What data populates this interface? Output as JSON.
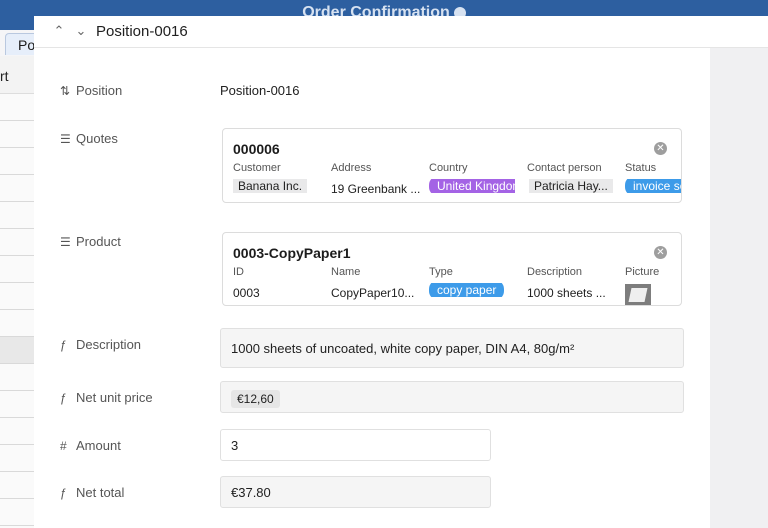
{
  "background": {
    "app_title": "Order Confirmation",
    "tab_label": "Po",
    "toolbar_text": "rt"
  },
  "modal": {
    "title": "Position-0016",
    "fields": {
      "position": {
        "label": "Position",
        "value": "Position-0016"
      },
      "quotes": {
        "label": "Quotes",
        "card": {
          "title": "000006",
          "columns": [
            "Customer",
            "Address",
            "Country",
            "Contact person",
            "Status"
          ],
          "values": [
            "Banana Inc.",
            "19 Greenbank ...",
            "United Kingdom",
            "Patricia Hay...",
            "invoice se"
          ]
        }
      },
      "product": {
        "label": "Product",
        "card": {
          "title": "0003-CopyPaper1",
          "columns": [
            "ID",
            "Name",
            "Type",
            "Description",
            "Picture"
          ],
          "values": [
            "0003",
            "CopyPaper10...",
            "copy paper",
            "1000 sheets ..."
          ]
        }
      },
      "description": {
        "label": "Description",
        "value": "1000 sheets of uncoated, white copy paper, DIN A4, 80g/m²"
      },
      "net_unit_price": {
        "label": "Net unit price",
        "value": "€12,60"
      },
      "amount": {
        "label": "Amount",
        "value": "3"
      },
      "net_total": {
        "label": "Net total",
        "value": "€37.80"
      }
    }
  },
  "colors": {
    "header_blue": "#2d5fa0",
    "chip_purple": "#a463e5",
    "chip_blue": "#3d9be9"
  }
}
